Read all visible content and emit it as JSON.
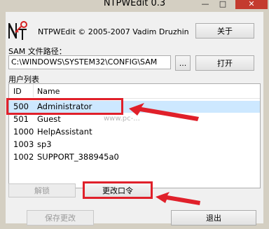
{
  "window": {
    "title": "NTPWEdit 0.3",
    "minimize": "—",
    "maximize": "□",
    "close": "✕"
  },
  "header": {
    "logo_text": "N T",
    "app_info": "NTPWEdit © 2005-2007 Vadim Druzhin",
    "about_button": "关于"
  },
  "sam": {
    "label": "SAM 文件路径：",
    "path_value": "C:\\WINDOWS\\SYSTEM32\\CONFIG\\SAM",
    "browse_button": "...",
    "open_button": "打开"
  },
  "users": {
    "label": "用户列表",
    "columns": [
      "ID",
      "Name"
    ],
    "rows": [
      {
        "id": "500",
        "name": "Administrator",
        "selected": true
      },
      {
        "id": "501",
        "name": "Guest",
        "selected": false
      },
      {
        "id": "1000",
        "name": "HelpAssistant",
        "selected": false
      },
      {
        "id": "1003",
        "name": "sp3",
        "selected": false
      },
      {
        "id": "1002",
        "name": "SUPPORT_388945a0",
        "selected": false
      }
    ]
  },
  "actions": {
    "unlock_button": "解锁",
    "change_password_button": "更改口令",
    "save_button": "保存更改",
    "exit_button": "退出"
  },
  "watermark": "www.pc-...",
  "colors": {
    "annotation_red": "#e0202a",
    "selected_row": "#cde8ff",
    "close_button": "#c43b2e"
  }
}
